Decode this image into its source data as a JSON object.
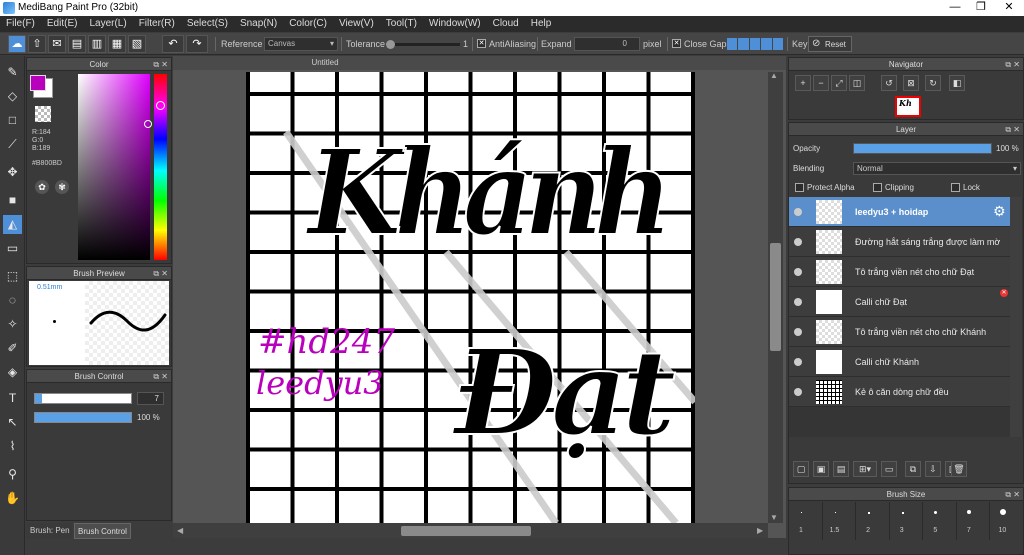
{
  "window": {
    "title": "MediBang Paint Pro (32bit)",
    "min": "—",
    "max": "❐",
    "close": "✕"
  },
  "menu": [
    "File(F)",
    "Edit(E)",
    "Layer(L)",
    "Filter(R)",
    "Select(S)",
    "Snap(N)",
    "Color(C)",
    "View(V)",
    "Tool(T)",
    "Window(W)",
    "Cloud",
    "Help"
  ],
  "toolbar": {
    "reference_label": "Reference",
    "reference_value": "Canvas",
    "tolerance_label": "Tolerance",
    "tolerance_value": "1",
    "antialias_label": "AntiAliasing",
    "expand_label": "Expand",
    "expand_value": "0",
    "expand_unit": "pixel",
    "closegaps_label": "Close Gaps",
    "key_label": "Key",
    "reset_label": "Reset"
  },
  "color_panel": {
    "title": "Color",
    "r": "R:184",
    "g": "G:0",
    "b": "B:189",
    "hex": "#B800BD",
    "primary": "#b800bd"
  },
  "brush_preview": {
    "title": "Brush Preview",
    "size": "0.51mm"
  },
  "brush_control": {
    "title": "Brush Control",
    "size_value": "7",
    "opacity_value": "100 %",
    "opacity_fraction": 1.0,
    "size_fraction": 0.07
  },
  "bottom_tabs": {
    "pen": "Brush: Pen",
    "control": "Brush Control"
  },
  "document": {
    "tab": "Untitled"
  },
  "canvas_text": {
    "tag1": "#hd247",
    "tag2": "leedyu3",
    "word1": "Khánh",
    "word2": "Đạt"
  },
  "navigator": {
    "title": "Navigator"
  },
  "layer_panel": {
    "title": "Layer",
    "opacity_label": "Opacity",
    "opacity_value": "100 %",
    "opacity_fraction": 1.0,
    "blending_label": "Blending",
    "blending_value": "Normal",
    "protect_alpha": "Protect Alpha",
    "clipping": "Clipping",
    "lock": "Lock",
    "layers": [
      {
        "name": "leedyu3 + hoidap",
        "selected": true
      },
      {
        "name": "Đường hắt sáng trắng được làm mờ",
        "selected": false
      },
      {
        "name": "Tô trắng viền nét cho chữ Đạt",
        "selected": false
      },
      {
        "name": "Calli chữ Đạt",
        "selected": false
      },
      {
        "name": "Tô trắng viền nét cho chữ Khánh",
        "selected": false
      },
      {
        "name": "Calli chữ Khánh",
        "selected": false
      },
      {
        "name": "Kẻ ô căn dòng chữ đều",
        "selected": false
      }
    ]
  },
  "brush_size": {
    "title": "Brush Size",
    "sizes": [
      "1",
      "1.5",
      "2",
      "3",
      "5",
      "7",
      "10"
    ]
  }
}
